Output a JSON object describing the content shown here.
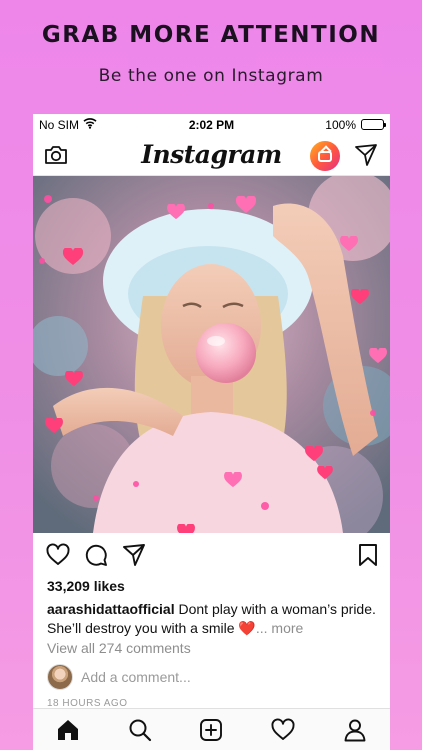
{
  "promo": {
    "title": "GRAB MORE ATTENTION",
    "subtitle": "Be the one on Instagram"
  },
  "status_bar": {
    "carrier": "No SIM",
    "time": "2:02 PM",
    "battery": "100%"
  },
  "app_bar": {
    "logo": "Instagram",
    "icons": [
      "camera-icon",
      "igtv-icon",
      "direct-send-icon"
    ]
  },
  "post": {
    "actions": [
      "heart-icon",
      "comment-icon",
      "share-icon",
      "bookmark-icon"
    ],
    "likes": "33,209 likes",
    "caption_user": "aarashidattaofficial",
    "caption_text": " Dont play with a woman’s pride. She’ll destroy you with a smile ",
    "caption_emoji": "❤️",
    "caption_more": "... more",
    "view_comments": "View all 274 comments",
    "add_comment_placeholder": "Add a comment...",
    "timestamp": "18 HOURS AGO"
  },
  "tab_bar": {
    "tabs": [
      "home-icon",
      "search-icon",
      "new-post-icon",
      "activity-icon",
      "profile-icon"
    ]
  },
  "colors": {
    "background": "#ef88e8",
    "heart": "#ff3f7a",
    "heart_light": "#ff9ad0",
    "caption_heart": "#e0245e"
  }
}
